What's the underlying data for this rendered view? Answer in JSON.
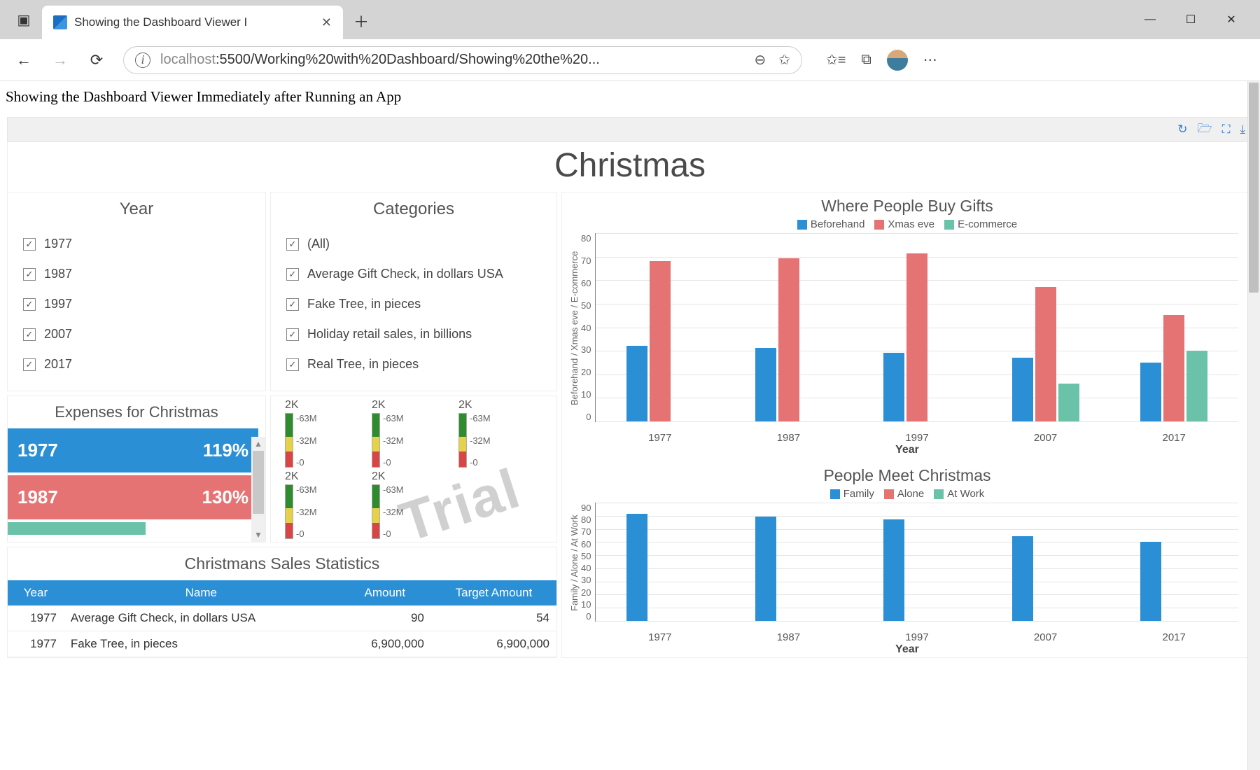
{
  "browser": {
    "tab_title": "Showing the Dashboard Viewer I",
    "url_host": "localhost",
    "url_path": ":5500/Working%20with%20Dashboard/Showing%20the%20...",
    "minimize": "—",
    "maximize": "☐",
    "close": "✕"
  },
  "page": {
    "heading": "Showing the Dashboard Viewer Immediately after Running an App"
  },
  "dashboard": {
    "title": "Christmas",
    "watermark": "Trial"
  },
  "filters": {
    "year_title": "Year",
    "years": [
      "1977",
      "1987",
      "1997",
      "2007",
      "2017"
    ],
    "categories_title": "Categories",
    "categories": [
      "(All)",
      "Average Gift Check, in dollars USA",
      "Fake Tree, in pieces",
      "Holiday retail sales, in billions",
      "Real Tree, in pieces"
    ]
  },
  "expenses": {
    "title": "Expenses for Christmas",
    "rows": [
      {
        "year": "1977",
        "pct": "119%",
        "class": "blue"
      },
      {
        "year": "1987",
        "pct": "130%",
        "class": "red"
      }
    ]
  },
  "gauges": {
    "top_label": "2K",
    "ticks": [
      "-63M",
      "-32M",
      "-0"
    ]
  },
  "stats": {
    "title": "Christmans Sales Statistics",
    "headers": [
      "Year",
      "Name",
      "Amount",
      "Target Amount"
    ],
    "rows": [
      [
        "1977",
        "Average Gift Check, in dollars USA",
        "90",
        "54"
      ],
      [
        "1977",
        "Fake Tree, in pieces",
        "6,900,000",
        "6,900,000"
      ]
    ]
  },
  "chart_data": [
    {
      "type": "bar",
      "title": "Where People Buy Gifts",
      "xlabel": "Year",
      "ylabel": "Beforehand / Xmas eve / E-commerce",
      "ylim": [
        0,
        80
      ],
      "categories": [
        "1977",
        "1987",
        "1997",
        "2007",
        "2017"
      ],
      "series": [
        {
          "name": "Beforehand",
          "color": "#2b8fd6",
          "values": [
            32,
            31,
            29,
            27,
            25
          ]
        },
        {
          "name": "Xmas eve",
          "color": "#e57373",
          "values": [
            68,
            69,
            71,
            57,
            45
          ]
        },
        {
          "name": "E-commerce",
          "color": "#6ac2a8",
          "values": [
            0,
            0,
            0,
            16,
            30
          ]
        }
      ]
    },
    {
      "type": "bar",
      "title": "People Meet Christmas",
      "xlabel": "Year",
      "ylabel": "Family / Alone / At Work",
      "ylim": [
        0,
        90
      ],
      "categories": [
        "1977",
        "1987",
        "1997",
        "2007",
        "2017"
      ],
      "series": [
        {
          "name": "Family",
          "color": "#2b8fd6",
          "values": [
            81,
            79,
            77,
            64,
            60
          ]
        },
        {
          "name": "Alone",
          "color": "#e57373",
          "values": [
            0,
            0,
            0,
            0,
            0
          ]
        },
        {
          "name": "At Work",
          "color": "#6ac2a8",
          "values": [
            0,
            0,
            0,
            0,
            0
          ]
        }
      ]
    }
  ]
}
